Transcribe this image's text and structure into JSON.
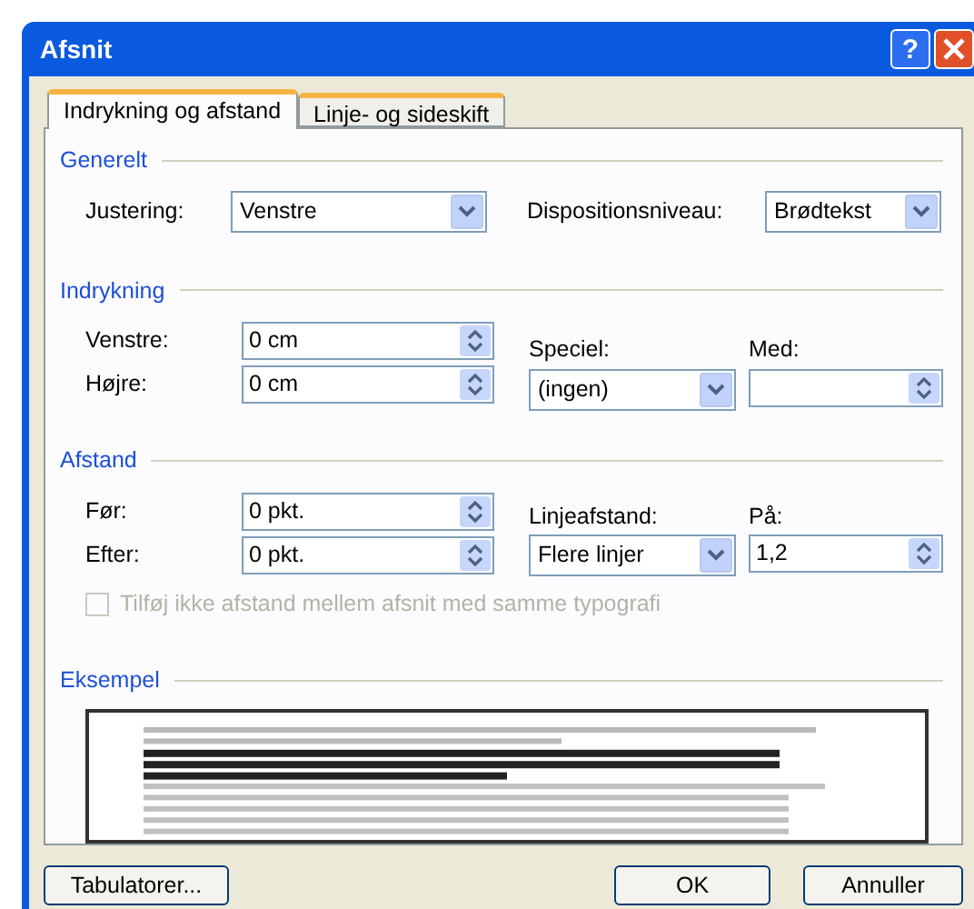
{
  "window": {
    "title": "Afsnit",
    "help_label": "?"
  },
  "tabs": [
    {
      "label": "Indrykning og afstand",
      "selected": true
    },
    {
      "label": "Linje- og sideskift",
      "selected": false
    }
  ],
  "generelt": {
    "title": "Generelt",
    "justering": {
      "label": "Justering:",
      "value": "Venstre"
    },
    "dispositionsniveau": {
      "label": "Dispositionsniveau:",
      "value": "Brødtekst"
    }
  },
  "indrykning": {
    "title": "Indrykning",
    "venstre": {
      "label": "Venstre:",
      "value": "0 cm"
    },
    "hoejre": {
      "label": "Højre:",
      "value": "0 cm"
    },
    "speciel": {
      "label": "Speciel:",
      "value": "(ingen)"
    },
    "med": {
      "label": "Med:"
    }
  },
  "afstand": {
    "title": "Afstand",
    "foer": {
      "label": "Før:",
      "value": "0 pkt."
    },
    "efter": {
      "label": "Efter:",
      "value": "0 pkt."
    },
    "linjeafstand": {
      "label": "Linjeafstand:",
      "value": "Flere linjer"
    },
    "paa": {
      "label": "På:",
      "value": "1,2"
    },
    "checkbox": {
      "label": "Tilføj ikke afstand mellem afsnit med samme typografi",
      "checked": false,
      "disabled": true
    }
  },
  "eksempel": {
    "title": "Eksempel"
  },
  "buttons": [
    {
      "label": "Tabulatorer..."
    },
    {
      "label": "OK"
    },
    {
      "label": "Annuller"
    }
  ]
}
